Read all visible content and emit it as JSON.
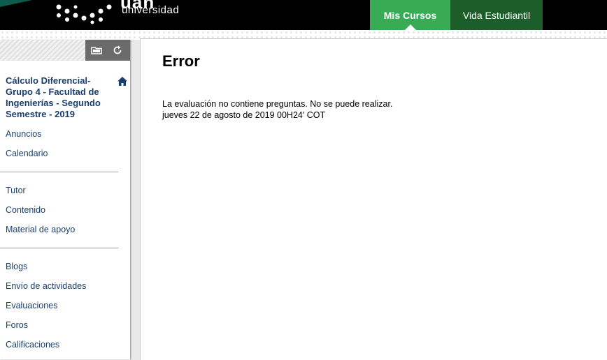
{
  "brand": {
    "word": "uan",
    "sub": "universidad"
  },
  "nav": {
    "mis_cursos": "Mis Cursos",
    "vida_estudiantil": "Vida Estudiantil"
  },
  "sidebar": {
    "course_title": "Cálculo Diferencial-Grupo 4 - Facultad de Ingenierías - Segundo Semestre - 2019",
    "group1": [
      "Anuncios",
      "Calendario"
    ],
    "group2": [
      "Tutor",
      "Contenido",
      "Material de apoyo"
    ],
    "group3": [
      "Blogs",
      "Envío de actividades",
      "Evaluaciones",
      "Foros",
      "Calificaciones"
    ]
  },
  "main": {
    "title": "Error",
    "message": "La evaluación no contiene preguntas. No se puede realizar.",
    "timestamp": "jueves 22 de agosto de 2019 00H24' COT"
  },
  "colors": {
    "active_tab": "#3aab55",
    "dark_tab": "#1d5d2a",
    "link": "#1a3f6e",
    "topbar": "#000000"
  }
}
